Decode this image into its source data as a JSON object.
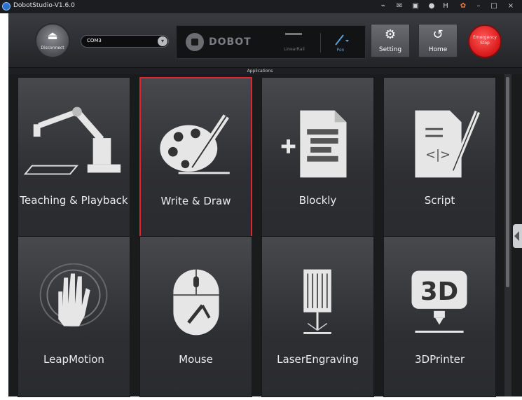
{
  "window": {
    "title": "DobotStudio-V1.6.0",
    "controls": [
      "wifi-icon",
      "mail-icon",
      "camera-icon",
      "info-icon",
      "help-icon",
      "skin-icon",
      "minimize-icon",
      "maximize-icon",
      "close-icon"
    ]
  },
  "toolbar": {
    "disconnect_label": "Disconnect",
    "port_value": "COM3",
    "brand": "DOBOT",
    "linearrail_label": "LinearRail",
    "pen_label": "Pen",
    "setting_label": "Setting",
    "home_label": "Home",
    "estop_label": "Emergency Stop"
  },
  "apps": {
    "header": "Applications",
    "tiles": [
      {
        "label": "Teaching & Playback",
        "icon": "robot-arm-icon"
      },
      {
        "label": "Write & Draw",
        "icon": "palette-pencil-icon"
      },
      {
        "label": "Blockly",
        "icon": "blockly-document-icon"
      },
      {
        "label": "Script",
        "icon": "script-document-icon"
      },
      {
        "label": "LeapMotion",
        "icon": "hand-icon"
      },
      {
        "label": "Mouse",
        "icon": "mouse-icon"
      },
      {
        "label": "LaserEngraving",
        "icon": "laser-icon"
      },
      {
        "label": "3DPrinter",
        "icon": "3d-printer-icon"
      }
    ],
    "selected_index": 1
  },
  "colors": {
    "selected_border": "#e0262b",
    "estop": "#d81818",
    "pen_accent": "#5aa0d8"
  }
}
